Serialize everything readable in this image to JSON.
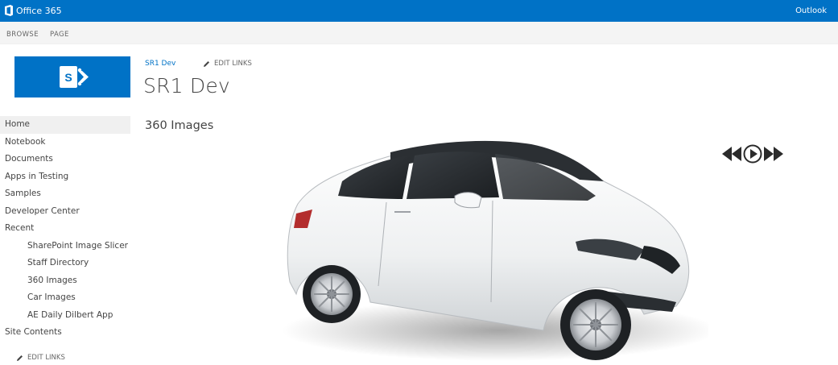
{
  "topbar": {
    "brand": "Office 365",
    "right_link": "Outlook"
  },
  "ribbon": {
    "tabs": [
      "BROWSE",
      "PAGE"
    ]
  },
  "header": {
    "breadcrumb": "SR1 Dev",
    "edit_links": "EDIT LINKS",
    "title": "SR1 Dev"
  },
  "nav": {
    "items": [
      {
        "label": "Home",
        "selected": true,
        "sub": false
      },
      {
        "label": "Notebook",
        "sub": false
      },
      {
        "label": "Documents",
        "sub": false
      },
      {
        "label": "Apps in Testing",
        "sub": false
      },
      {
        "label": "Samples",
        "sub": false
      },
      {
        "label": "Developer Center",
        "sub": false
      },
      {
        "label": "Recent",
        "sub": false
      },
      {
        "label": "SharePoint Image Slicer",
        "sub": true
      },
      {
        "label": "Staff Directory",
        "sub": true
      },
      {
        "label": "360 Images",
        "sub": true
      },
      {
        "label": "Car Images",
        "sub": true
      },
      {
        "label": "AE Daily Dilbert App",
        "sub": true
      },
      {
        "label": "Site Contents",
        "sub": false
      }
    ],
    "edit_links": "EDIT LINKS"
  },
  "main": {
    "section_title": "360 Images"
  },
  "player": {
    "icons": [
      "rewind-icon",
      "play-icon",
      "forward-icon"
    ]
  },
  "colors": {
    "brand_blue": "#0072c6",
    "nav_selected": "#f0f0f0",
    "ribbon_bg": "#f4f4f4"
  }
}
